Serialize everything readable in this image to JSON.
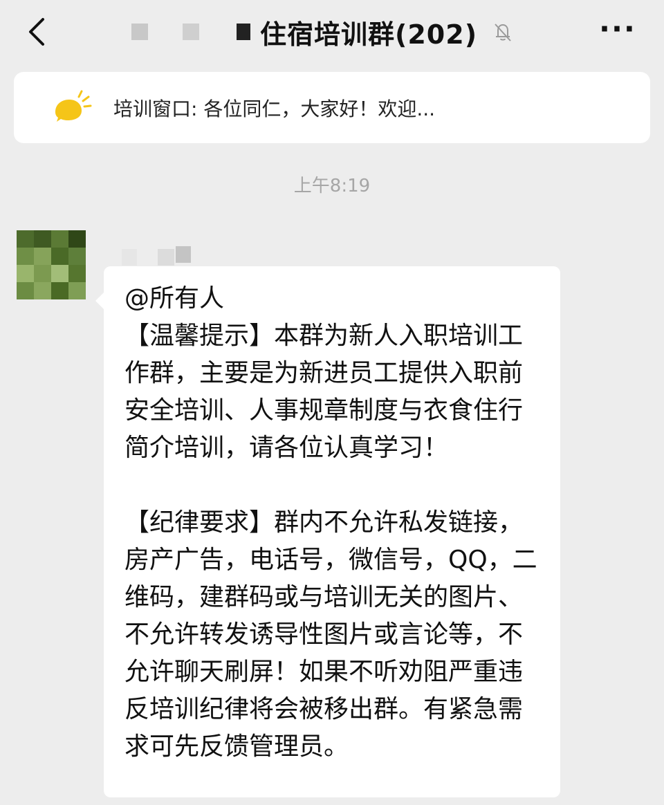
{
  "header": {
    "title": "住宿培训群(202)",
    "more_label": "···"
  },
  "notice": {
    "text": "培训窗口: 各位同仁，大家好！欢迎..."
  },
  "timestamp": "上午8:19",
  "message": {
    "text": "@所有人\n【温馨提示】本群为新人入职培训工作群，主要是为新进员工提供入职前安全培训、人事规章制度与衣食住行简介培训，请各位认真学习！\n\n【纪律要求】群内不允许私发链接，房产广告，电话号，微信号，QQ，二维码，建群码或与培训无关的图片、不允许转发诱导性图片或言论等，不允许聊天刷屏！如果不听劝阻严重违反培训纪律将会被移出群。有紧急需求可先反馈管理员。"
  },
  "colors": {
    "background": "#ededed",
    "bubble": "#ffffff",
    "notice_icon": "#f5c518",
    "timestamp": "#a6a6a6"
  },
  "icons": {
    "back": "chevron-left-icon",
    "mute": "bell-off-icon",
    "more": "more-dots-icon",
    "notice": "announcement-sun-icon"
  }
}
